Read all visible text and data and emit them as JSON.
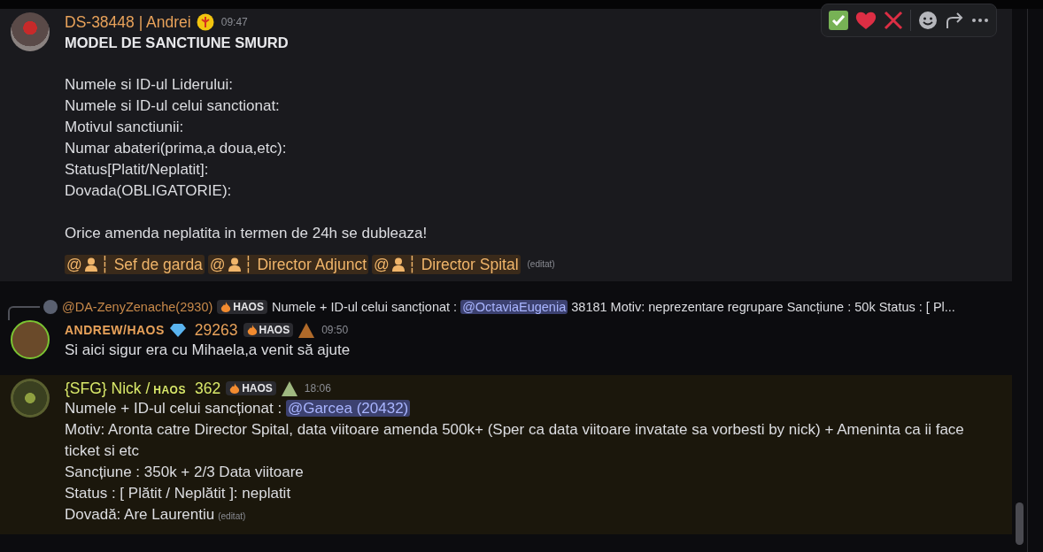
{
  "toolbar": {
    "reactions": [
      {
        "kind": "check"
      },
      {
        "kind": "heart"
      },
      {
        "kind": "cross"
      }
    ]
  },
  "messages": [
    {
      "highlighted": true,
      "author": {
        "name": "DS-38448 | Andrei",
        "color": "#e8a25a"
      },
      "time": "09:47",
      "heading": "MODEL DE SANCTIUNE SMURD",
      "paragraphs": [
        [
          "Numele si ID-ul Liderului:",
          "Numele si ID-ul celui sanctionat:",
          "Motivul sanctiunii:",
          "Numar abateri(prima,a doua,etc):",
          "Status[Platit/Neplatit]:",
          "Dovada(OBLIGATORIE):"
        ],
        [
          "Orice amenda neplatita in termen de 24h se dubleaza!"
        ]
      ],
      "roles": [
        {
          "at": "@",
          "label": "┆ Sef de garda"
        },
        {
          "at": "@",
          "label": "┆ Director Adjunct"
        },
        {
          "at": "@",
          "label": "┆ Director Spital"
        }
      ],
      "edited": "(editat)"
    },
    {
      "highlighted": false,
      "reply": {
        "author": "@DA-ZenyZenache(2930)",
        "tag": "HAOS",
        "text": "Numele + ID-ul celui sancționat :",
        "mention": "@OctaviaEugenia",
        "rest": "38181 Motiv: neprezentare regrupare  Sancțiune : 50k Status : [ Pl..."
      },
      "author": {
        "name": "ANDREW/HAOS",
        "small": true,
        "color": "#e8a25a"
      },
      "number": "29263",
      "tag": "HAOS",
      "time": "09:50",
      "lines": [
        {
          "text": "Si aici sigur era cu Mihaela,a venit să ajute"
        }
      ]
    },
    {
      "highlighted": true,
      "author": {
        "name": "{SFG} Nick /",
        "suffix": "HAOS",
        "color": "#d9e86a"
      },
      "number": "362",
      "tag": "HAOS",
      "time": "18:06",
      "lines": [
        {
          "text": "Numele + ID-ul celui sancționat :",
          "mention": "@Garcea (20432)"
        },
        {
          "text": "Motiv: Aronta catre Director Spital, data viitoare amenda 500k+ (Sper ca data viitoare invatate sa vorbesti by nick) + Ameninta ca ii face ticket si etc"
        },
        {
          "text": "Sancțiune : 350k + 2/3 Data viitoare"
        },
        {
          "text": "Status : [ Plătit / Neplătit ]: neplatit"
        },
        {
          "text": "Dovadă: Are Laurentiu"
        }
      ],
      "edited": "(editat)"
    }
  ]
}
